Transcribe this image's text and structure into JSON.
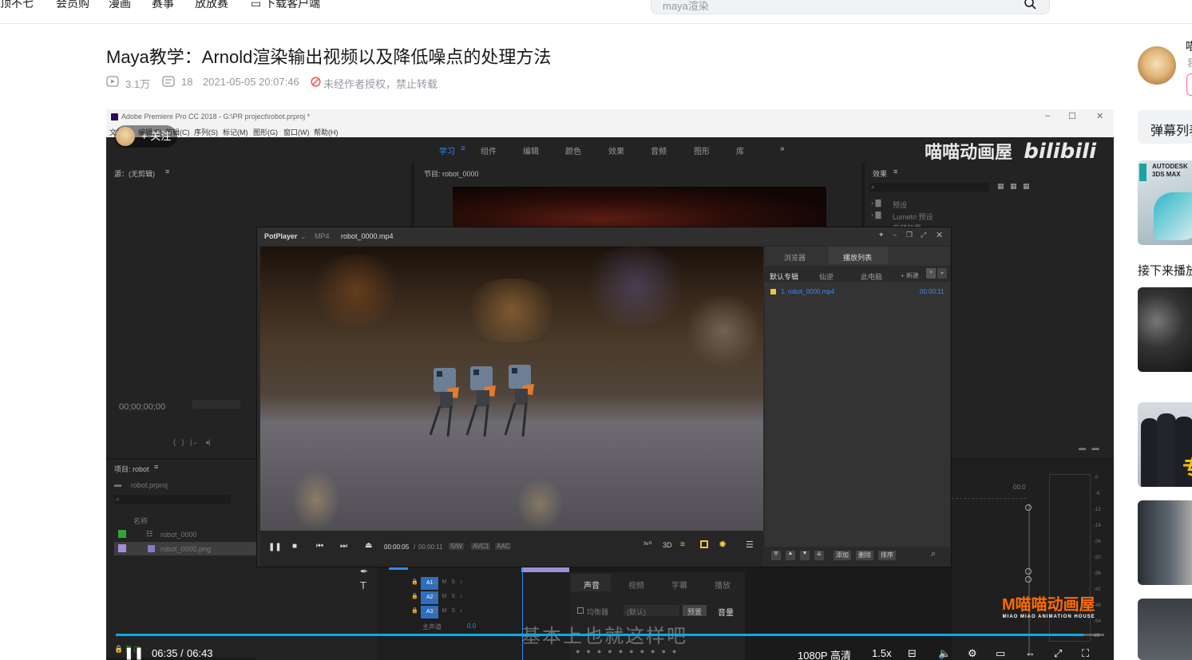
{
  "nav": {
    "items": [
      "顶不七",
      "会员购",
      "漫画",
      "赛事",
      "放放赛",
      "下载客户端"
    ],
    "search_placeholder": "maya渲染"
  },
  "video": {
    "title": "Maya教学：Arnold渲染输出视频以及降低噪点的处理方法",
    "views": "3.1万",
    "danmaku_count": "18",
    "publish_time": "2021-05-05 20:07:46",
    "copyright_notice": "未经作者授权，禁止转载"
  },
  "premiere": {
    "window_title": "Adobe Premiere Pro CC 2018 - G:\\PR project\\robot.prproj *",
    "menu": [
      "文件(F)",
      "编辑(E)",
      "剪辑(C)",
      "序列(S)",
      "标记(M)",
      "图形(G)",
      "窗口(W)",
      "帮助(H)"
    ],
    "workspaces": [
      "学习",
      "组件",
      "编辑",
      "颜色",
      "效果",
      "音频",
      "图形",
      "库",
      "»"
    ],
    "source_panel": "源：(无剪辑)",
    "program_panel": "节目: robot_0000",
    "effects_panel": "效果",
    "effects_items": [
      "预设",
      "Lumetri 预设",
      "音频效果"
    ],
    "timecode": "00;00;00;00",
    "project_panel": "项目: robot",
    "project_file": "robot.prproj",
    "column_name": "名称",
    "project_items": [
      "robot_0000",
      "robot_0000.png"
    ],
    "tracks": [
      "A1",
      "A2",
      "A3"
    ],
    "master_track": "主声道",
    "master_value": "0.0",
    "mixer_tabs": [
      "声音",
      "视频",
      "字幕",
      "播放"
    ],
    "mixer_preset": "(默认)",
    "mixer_preset_btn": "预置",
    "mixer_volume": "音量",
    "mixer_eq": "均衡器",
    "meter_scale": [
      "0",
      "-6",
      "-12",
      "-18",
      "-24",
      "-30",
      "-36",
      "-42",
      "-48",
      "-54",
      "dB"
    ],
    "timeline_time": "00:0"
  },
  "potplayer": {
    "app_name": "PotPlayer",
    "format": "MP4",
    "filename": "robot_0000.mp4",
    "tabs": [
      "浏览器",
      "播放列表"
    ],
    "subtabs": [
      "默认专辑",
      "仙逆",
      "此电脑",
      "+ 新建"
    ],
    "playlist": [
      {
        "name": "1. robot_0000.mp4",
        "duration": "00:00:11"
      }
    ],
    "current_time": "00:00:05",
    "total_time": "00:00:11",
    "codec_tags": [
      "S/W",
      "AVC1",
      "AAC"
    ],
    "list_buttons": [
      "添加",
      "删除",
      "排序"
    ]
  },
  "overlay": {
    "follow_label": "+ 关注",
    "watermark": "喵喵动画屋",
    "watermark_logo": "bilibili",
    "subtitle": "基本上也就这样吧",
    "brand": "M喵喵动画屋",
    "brand_sub": "MIAO MIAO ANIMATION HOUSE"
  },
  "controls": {
    "current": "06:35",
    "total": "06:43",
    "progress": 0.979,
    "quality": "1080P 高清",
    "speed": "1.5x"
  },
  "sidebar": {
    "up_name": "喵",
    "up_desc": "我",
    "danmaku_list": "弹幕列表",
    "next_up": "接下来播放",
    "thumb1_text": "AUTODESK 3DS MAX",
    "thumb3_badge": "专"
  }
}
